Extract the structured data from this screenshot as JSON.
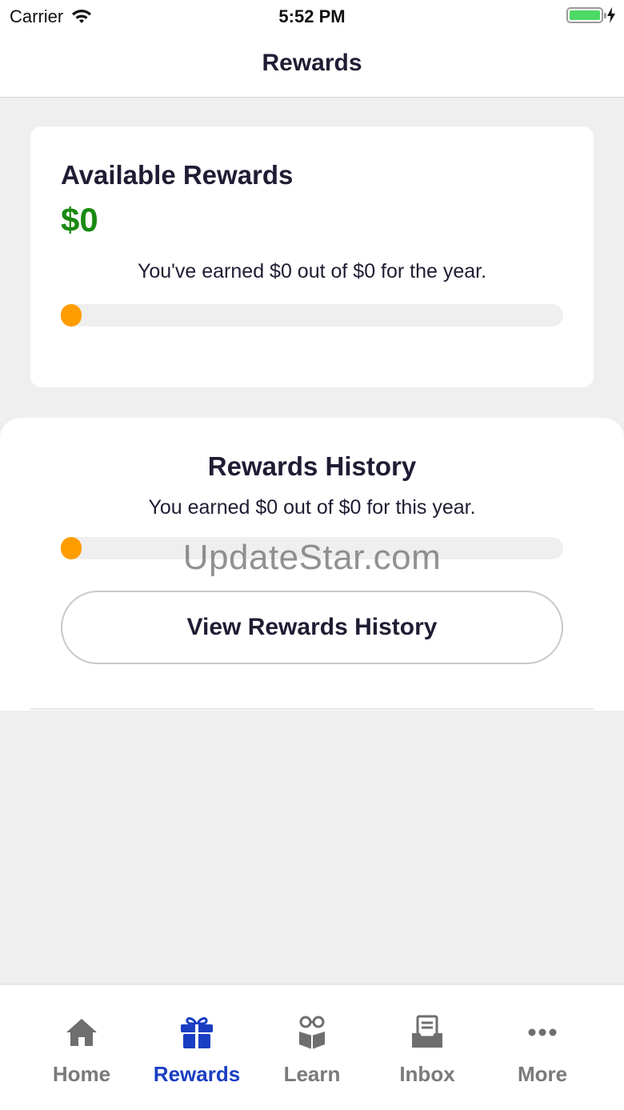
{
  "status_bar": {
    "carrier": "Carrier",
    "time": "5:52 PM",
    "battery_level": 1.0
  },
  "nav": {
    "title": "Rewards"
  },
  "available": {
    "title": "Available Rewards",
    "amount": "$0",
    "note": "You've earned $0 out of $0 for the year.",
    "progress": 0
  },
  "history": {
    "title": "Rewards History",
    "note": "You earned $0 out of $0 for this year.",
    "progress": 0,
    "button_label": "View Rewards History"
  },
  "watermark": "UpdateStar.com",
  "tabs": [
    {
      "label": "Home",
      "icon": "home-icon",
      "active": false
    },
    {
      "label": "Rewards",
      "icon": "gift-icon",
      "active": true
    },
    {
      "label": "Learn",
      "icon": "learn-icon",
      "active": false
    },
    {
      "label": "Inbox",
      "icon": "inbox-icon",
      "active": false
    },
    {
      "label": "More",
      "icon": "more-icon",
      "active": false
    }
  ],
  "colors": {
    "accent": "#1a3ec2",
    "amount": "#1a8a12",
    "progress_knob": "#ff9d00",
    "inactive_tab": "#7a7a7a"
  }
}
